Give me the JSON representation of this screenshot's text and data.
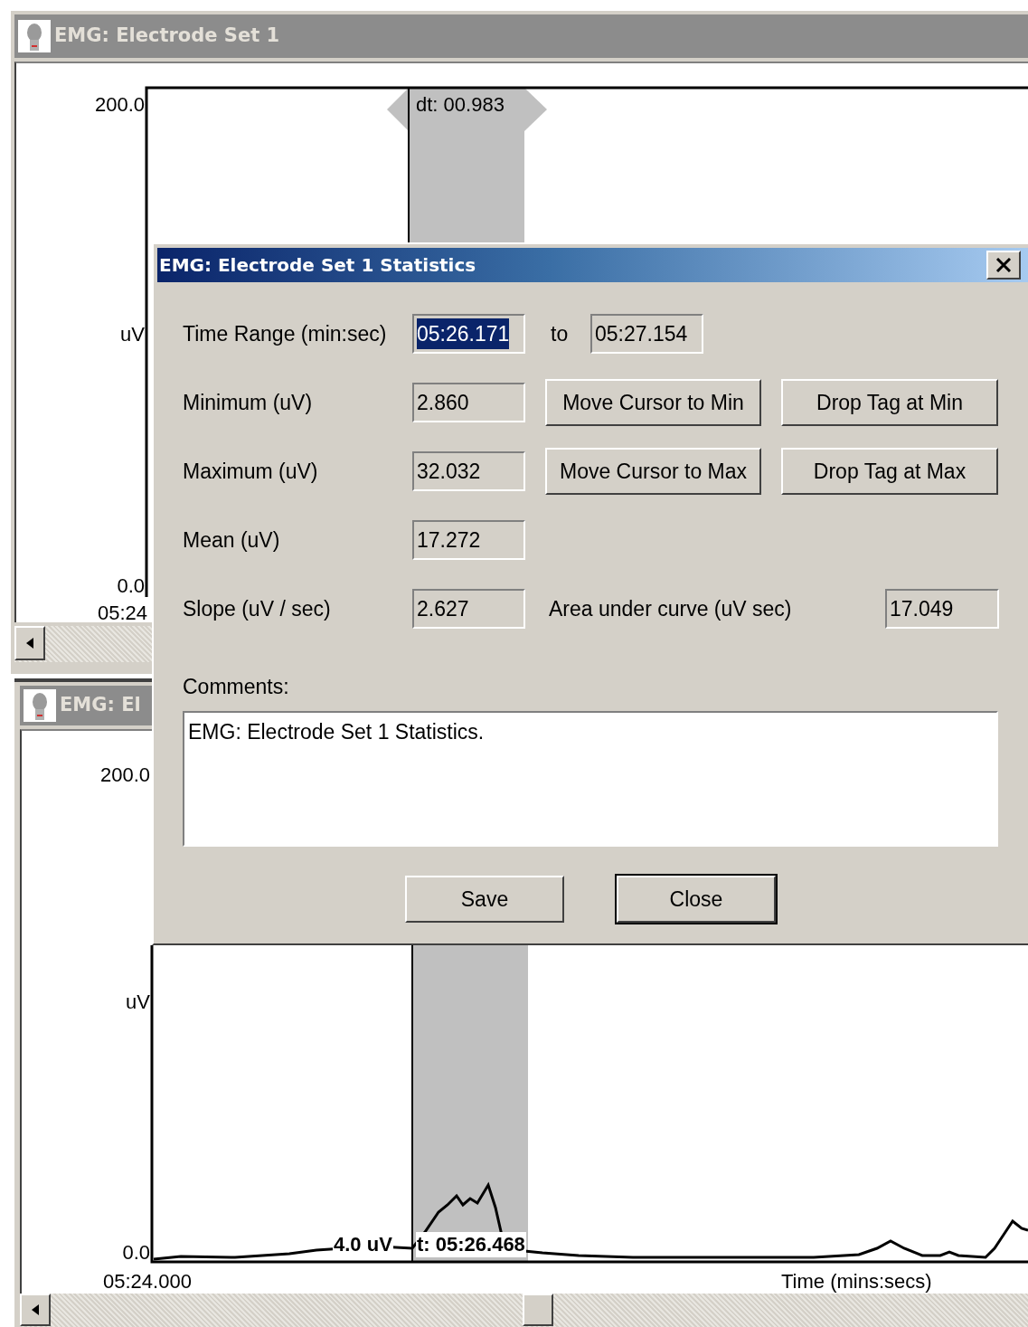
{
  "plot_window": {
    "title": "EMG: Electrode Set 1",
    "y_max": "200.0",
    "y_unit": "uV",
    "y_min": "0.0",
    "x_start": "05:24",
    "interval_tag": "dt: 00.983"
  },
  "second_window": {
    "title": "EMG: El",
    "y_max": "200.0",
    "y_unit": "uV",
    "y_min": "0.0",
    "x_start": "05:24.000",
    "x_axis_title": "Time (mins:secs)",
    "cursor_readout": [
      "4.0 uV",
      "t: 05:26.468"
    ]
  },
  "dialog": {
    "title": "EMG: Electrode Set 1 Statistics",
    "time_range": {
      "label": "Time Range (min:sec)",
      "from": {
        "value": "05:26.171",
        "selected": true
      },
      "to_label": "to",
      "to": {
        "value": "05:27.154",
        "selected": false
      }
    },
    "stats": [
      {
        "kind": "buttons",
        "label": "Minimum (uV)",
        "value": "2.860",
        "buttons": [
          "Move Cursor to Min",
          "Drop Tag at Min"
        ]
      },
      {
        "kind": "buttons",
        "label": "Maximum (uV)",
        "value": "32.032",
        "buttons": [
          "Move Cursor to Max",
          "Drop Tag at Max"
        ]
      },
      {
        "kind": "plain",
        "label": "Mean (uV)",
        "value": "17.272"
      },
      {
        "kind": "extra",
        "label": "Slope (uV / sec)",
        "value": "2.627",
        "extra_label": "Area under curve (uV sec)",
        "extra_value": "17.049"
      }
    ],
    "comments": {
      "label": "Comments:",
      "value": "EMG: Electrode Set 1 Statistics."
    },
    "buttons": [
      {
        "label": "Save",
        "default": false
      },
      {
        "label": "Close",
        "default": true
      }
    ]
  }
}
